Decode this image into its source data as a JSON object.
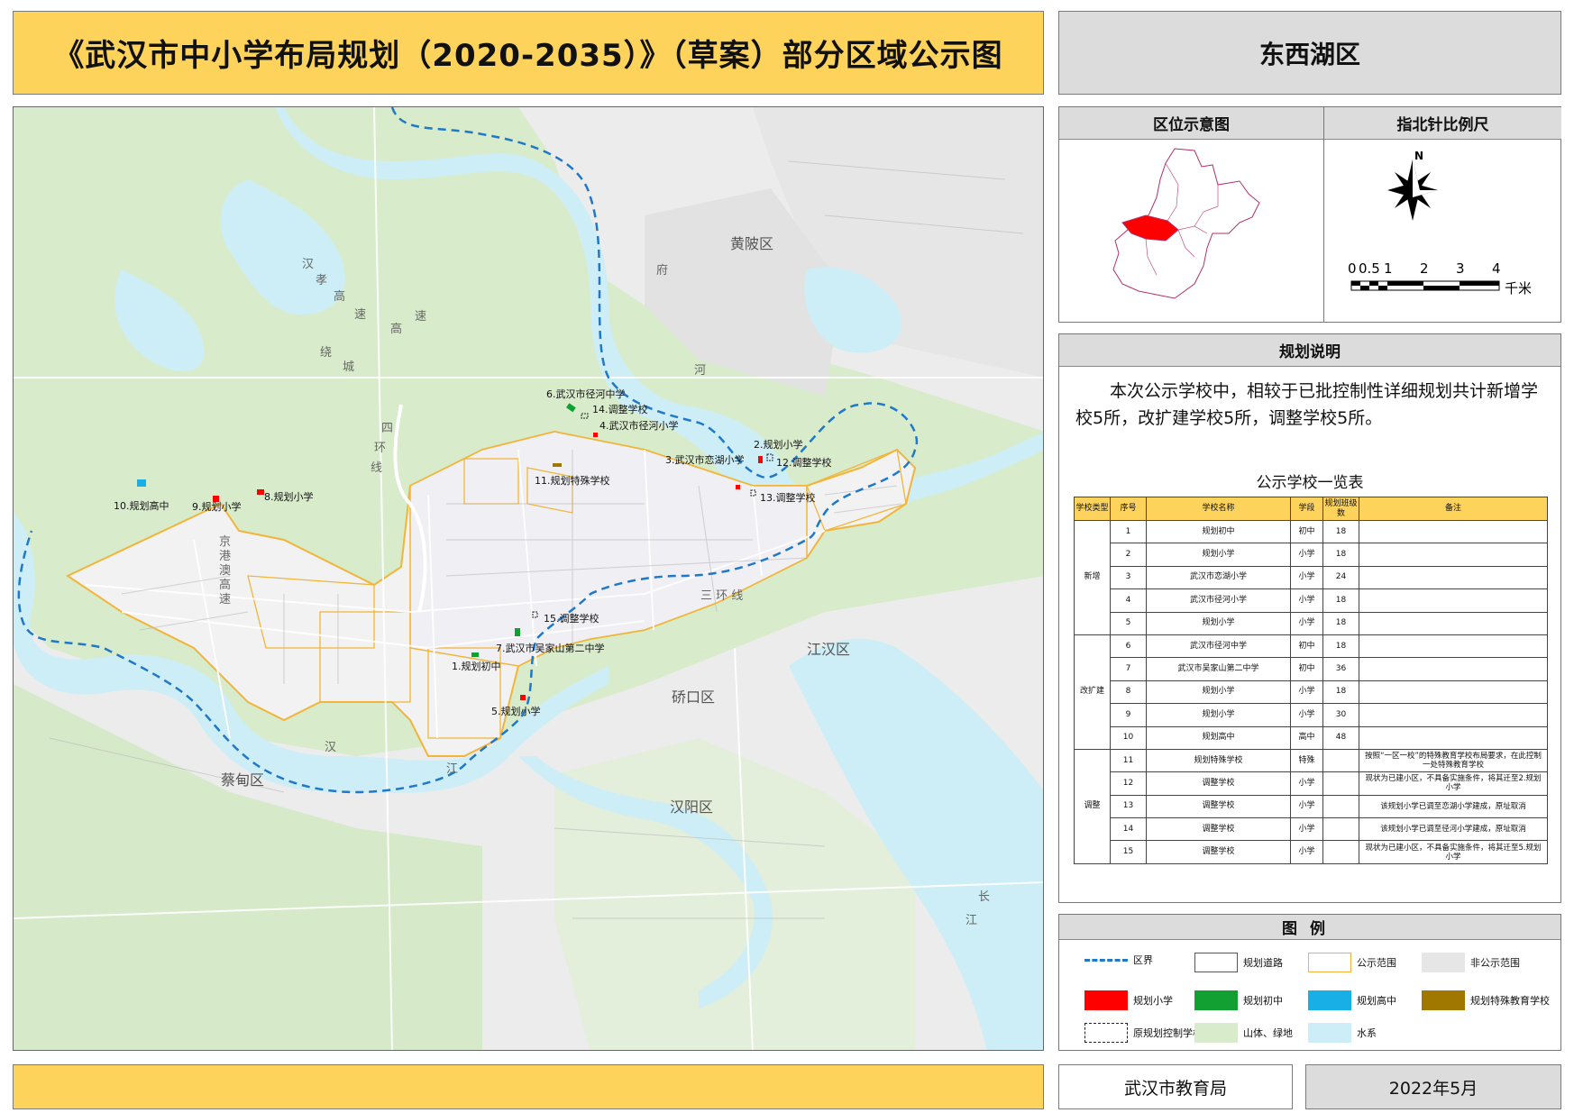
{
  "header": {
    "title": "《武汉市中小学布局规划（2020-2035）》（草案）部分区域公示图",
    "district": "东西湖区"
  },
  "map": {
    "district_labels": [
      {
        "text": "黄陂区"
      },
      {
        "text": "江汉区"
      },
      {
        "text": "硚口区"
      },
      {
        "text": "蔡甸区"
      },
      {
        "text": "汉阳区"
      }
    ],
    "road_labels": {
      "gaosu_left": [
        "汉",
        "孝",
        "高",
        "速"
      ],
      "raocheng": [
        "绕",
        "城",
        "高",
        "速"
      ],
      "sihuan": [
        "四",
        "环",
        "线"
      ],
      "jinggang": [
        "京",
        "港",
        "澳",
        "高",
        "速"
      ],
      "sanhuan": "三  环  线",
      "fuhe": [
        "府",
        "河"
      ],
      "hanjiang": [
        "汉",
        "江"
      ],
      "changjiang": [
        "长",
        "江"
      ]
    },
    "school_labels": [
      {
        "id": "1",
        "text": "1.规划初中",
        "category": "规划初中"
      },
      {
        "id": "2",
        "text": "2.规划小学",
        "category": "规划小学"
      },
      {
        "id": "3",
        "text": "3.武汉市恋湖小学",
        "category": "规划小学"
      },
      {
        "id": "4",
        "text": "4.武汉市径河小学",
        "category": "规划小学"
      },
      {
        "id": "5",
        "text": "5.规划小学",
        "category": "规划小学"
      },
      {
        "id": "6",
        "text": "6.武汉市径河中学",
        "category": "规划初中"
      },
      {
        "id": "7",
        "text": "7.武汉市吴家山第二中学",
        "category": "规划初中"
      },
      {
        "id": "8",
        "text": "8.规划小学",
        "category": "规划小学"
      },
      {
        "id": "9",
        "text": "9.规划小学",
        "category": "规划小学"
      },
      {
        "id": "10",
        "text": "10.规划高中",
        "category": "规划高中"
      },
      {
        "id": "11",
        "text": "11.规划特殊学校",
        "category": "规划特殊教育学校"
      },
      {
        "id": "12",
        "text": "12.调整学校",
        "category": "原规划控制学校"
      },
      {
        "id": "13",
        "text": "13.调整学校",
        "category": "原规划控制学校"
      },
      {
        "id": "14",
        "text": "14.调整学校",
        "category": "原规划控制学校"
      },
      {
        "id": "15",
        "text": "15.调整学校",
        "category": "原规划控制学校"
      }
    ]
  },
  "inset": {
    "location_title": "区位示意图",
    "compass_title": "指北针比例尺",
    "north_letter": "N",
    "scale_ticks": [
      "0",
      "0.5",
      "1",
      "2",
      "3",
      "4"
    ],
    "scale_unit": "千米"
  },
  "description": {
    "title": "规划说明",
    "text": "本次公示学校中，相较于已批控制性详细规划共计新增学校5所，改扩建学校5所，调整学校5所。",
    "table_title": "公示学校一览表",
    "columns": [
      "学校类型",
      "序号",
      "学校名称",
      "学段",
      "规划班级数",
      "备注"
    ],
    "groups": [
      {
        "type": "新增",
        "rows": [
          {
            "no": "1",
            "name": "规划初中",
            "stage": "初中",
            "classes": "18",
            "note": ""
          },
          {
            "no": "2",
            "name": "规划小学",
            "stage": "小学",
            "classes": "18",
            "note": ""
          },
          {
            "no": "3",
            "name": "武汉市恋湖小学",
            "stage": "小学",
            "classes": "24",
            "note": ""
          },
          {
            "no": "4",
            "name": "武汉市径河小学",
            "stage": "小学",
            "classes": "18",
            "note": ""
          },
          {
            "no": "5",
            "name": "规划小学",
            "stage": "小学",
            "classes": "18",
            "note": ""
          }
        ]
      },
      {
        "type": "改扩建",
        "rows": [
          {
            "no": "6",
            "name": "武汉市径河中学",
            "stage": "初中",
            "classes": "18",
            "note": ""
          },
          {
            "no": "7",
            "name": "武汉市吴家山第二中学",
            "stage": "初中",
            "classes": "36",
            "note": ""
          },
          {
            "no": "8",
            "name": "规划小学",
            "stage": "小学",
            "classes": "18",
            "note": ""
          },
          {
            "no": "9",
            "name": "规划小学",
            "stage": "小学",
            "classes": "30",
            "note": ""
          },
          {
            "no": "10",
            "name": "规划高中",
            "stage": "高中",
            "classes": "48",
            "note": ""
          }
        ]
      },
      {
        "type": "调整",
        "rows": [
          {
            "no": "11",
            "name": "规划特殊学校",
            "stage": "特殊",
            "classes": "",
            "note": "按照“一区一校”的特殊教育学校布局要求，在此控制一处特殊教育学校"
          },
          {
            "no": "12",
            "name": "调整学校",
            "stage": "小学",
            "classes": "",
            "note": "现状为已建小区，不具备实施条件，将其迁至2.规划小学"
          },
          {
            "no": "13",
            "name": "调整学校",
            "stage": "小学",
            "classes": "",
            "note": "该规划小学已调至恋湖小学建成，原址取消"
          },
          {
            "no": "14",
            "name": "调整学校",
            "stage": "小学",
            "classes": "",
            "note": "该规划小学已调至径河小学建成，原址取消"
          },
          {
            "no": "15",
            "name": "调整学校",
            "stage": "小学",
            "classes": "",
            "note": "现状为已建小区，不具备实施条件，将其迁至5.规划小学"
          }
        ]
      }
    ]
  },
  "legend": {
    "title": "图例",
    "items": [
      {
        "label": "区界",
        "style": "dash",
        "color": "#1f78c8"
      },
      {
        "label": "规划道路",
        "style": "road",
        "color": "#555555"
      },
      {
        "label": "公示范围",
        "style": "outline",
        "color": "#f2b53a"
      },
      {
        "label": "非公示范围",
        "style": "fill",
        "color": "#e6e6e6"
      },
      {
        "label": "规划小学",
        "style": "fill",
        "color": "#ff0000"
      },
      {
        "label": "规划初中",
        "style": "fill",
        "color": "#12a032"
      },
      {
        "label": "规划高中",
        "style": "fill",
        "color": "#18aee6"
      },
      {
        "label": "规划特殊教育学校",
        "style": "fill",
        "color": "#a07800"
      },
      {
        "label": "原规划控制学校",
        "style": "dashbox",
        "color": "#222222"
      },
      {
        "label": "山体、绿地",
        "style": "fill",
        "color": "#d8ebcb"
      },
      {
        "label": "水系",
        "style": "fill",
        "color": "#cdeef7"
      }
    ]
  },
  "footer": {
    "org": "武汉市教育局",
    "date": "2022年5月"
  },
  "colors": {
    "header_yellow": "#fdd35c",
    "panel_gray": "#dcdcdc",
    "water": "#cdeef7",
    "green": "#d8ebcb",
    "boundary": "#1f78c8",
    "scope": "#f2b53a",
    "inset_highlight": "#ff0000"
  }
}
